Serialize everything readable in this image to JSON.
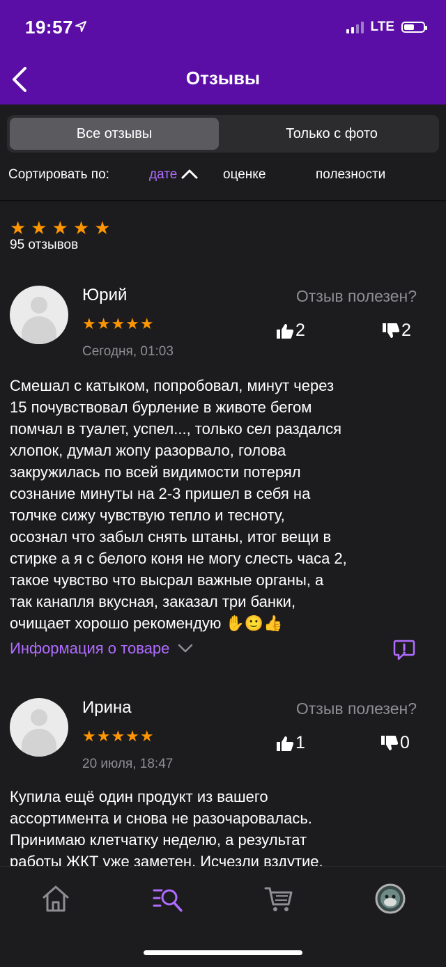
{
  "status": {
    "time": "19:57",
    "network": "LTE"
  },
  "header": {
    "title": "Отзывы"
  },
  "tabs": {
    "all": "Все отзывы",
    "photo": "Только с фото"
  },
  "sort": {
    "label": "Сортировать по:",
    "date": "дате",
    "rating": "оценке",
    "usefulness": "полезности"
  },
  "summary": {
    "stars": "★★★★★",
    "count": "95 отзывов"
  },
  "reviews": [
    {
      "name": "Юрий",
      "stars": "★★★★★",
      "date": "Сегодня, 01:03",
      "question": "Отзыв полезен?",
      "likes": "2",
      "dislikes": "2",
      "text": "Смешал с катыком, попробовал, минут через\n15 почувствовал бурление в животе бегом\nпомчал в туалет, успел..., только сел раздался\nхлопок, думал жопу разорвало, голова\nзакружилась по всей видимости потерял\nсознание минуты на 2-3 пришел в себя на\nтолчке сижу чувствую тепло и тесноту,\nосознал что забыл снять штаны, итог вещи в\nстирке а я с белого коня не могу слесть часа 2,\nтакое чувство что высрал важные органы, а\nтак канапля вкусная, заказал три банки,\nочищает  хорошо рекомендую ✋🙂👍",
      "info_link": "Информация о товаре"
    },
    {
      "name": "Ирина",
      "stars": "★★★★★",
      "date": "20 июля, 18:47",
      "question": "Отзыв полезен?",
      "likes": "1",
      "dislikes": "0",
      "text": "Купила ещё один продукт из вашего\nассортимента и снова не разочаровалась.\nПринимаю клетчатку неделю, а результат\nработы ЖКТ уже заметен. Исчезли вздутие,"
    }
  ],
  "colors": {
    "header": "#5a0ea6",
    "accent": "#b06cff",
    "stars": "#ff9500",
    "background": "#1c1c1e"
  }
}
